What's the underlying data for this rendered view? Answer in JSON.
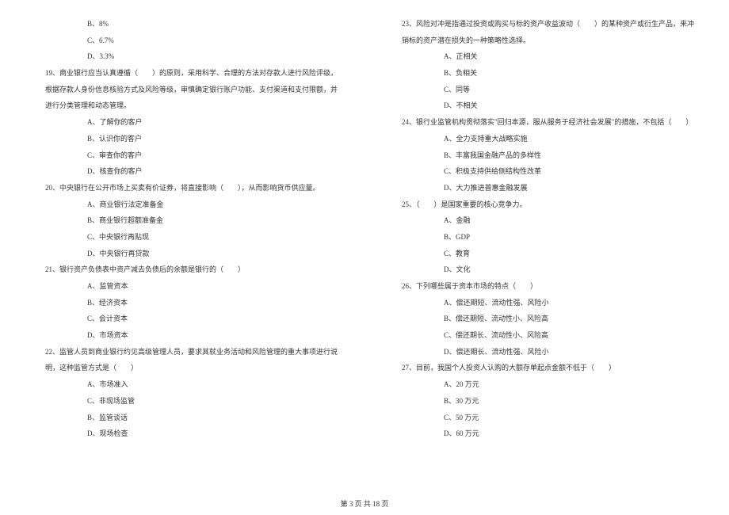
{
  "left_column": {
    "q18_options": [
      "B、8%",
      "C、6.7%",
      "D、3.3%"
    ],
    "q19": {
      "text": "19、商业银行应当认真遵循（　　）的原则，采用科学、合理的方法对存款人进行风险评级，",
      "cont": "根据存款人身份信息核验方式及风险等级，审慎确定银行账户功能、支付渠道和支付限额，并",
      "cont2": "进行分类管理和动态管理。",
      "options": [
        "A、了解你的客户",
        "B、认识你的客户",
        "C、审查你的客户",
        "D、核查你的客户"
      ]
    },
    "q20": {
      "text": "20、中央银行在公开市场上买卖有价证券，将直接影响（　　），从而影响货币供应量。",
      "options": [
        "A、商业银行法定准备金",
        "B、商业银行超额准备金",
        "C、中央银行再贴现",
        "D、中央银行再贷款"
      ]
    },
    "q21": {
      "text": "21、银行资产负债表中资产减去负债后的余额是银行的（　　）",
      "options": [
        "A、监管资本",
        "B、经济资本",
        "C、会计资本",
        "D、市场资本"
      ]
    },
    "q22": {
      "text": "22、监管人员到商业银行约见高级管理人员，要求其就业务活动和风险管理的重大事项进行说",
      "cont": "明，这种监管方式是（　　）",
      "options": [
        "A、市场准入",
        "C、非现场监管",
        "B、监管谈话",
        "D、现场检查"
      ]
    }
  },
  "right_column": {
    "q23": {
      "text": "23、风险对冲是指通过投资或购买与标的资产收益波动（　　）的某种资产或衍生产品，来冲",
      "cont": "销标的资产潜在损失的一种策略性选择。",
      "options": [
        "A、正相关",
        "B、负相关",
        "C、同等",
        "D、不相关"
      ]
    },
    "q24": {
      "text": "24、银行业监管机构贯彻落实\"回归本源，服从服务于经济社会发展\"的措施，不包括（　　）",
      "options": [
        "A、全力支持重大战略实施",
        "B、丰富我国金融产品的多样性",
        "C、积极支持供给侧结构性改革",
        "D、大力推进普惠金融发展"
      ]
    },
    "q25": {
      "text": "25、（　　）是国家重要的核心竞争力。",
      "options": [
        "A、金融",
        "B、GDP",
        "C、教育",
        "D、文化"
      ]
    },
    "q26": {
      "text": "26、下列哪些属于资本市场的特点（　　）",
      "options": [
        "A、偿还期短、流动性强、风险小",
        "B、偿还期短、流动性小、风险高",
        "C、偿还期长、流动性小、风险高",
        "D、偿还期长、流动性强、风险小"
      ]
    },
    "q27": {
      "text": "27、目前，我国个人投资人认购的大额存单起点金额不低于（　　）",
      "options": [
        "A、20 万元",
        "B、30 万元",
        "C、50 万元",
        "D、60 万元"
      ]
    }
  },
  "footer": "第 3 页 共 18 页"
}
